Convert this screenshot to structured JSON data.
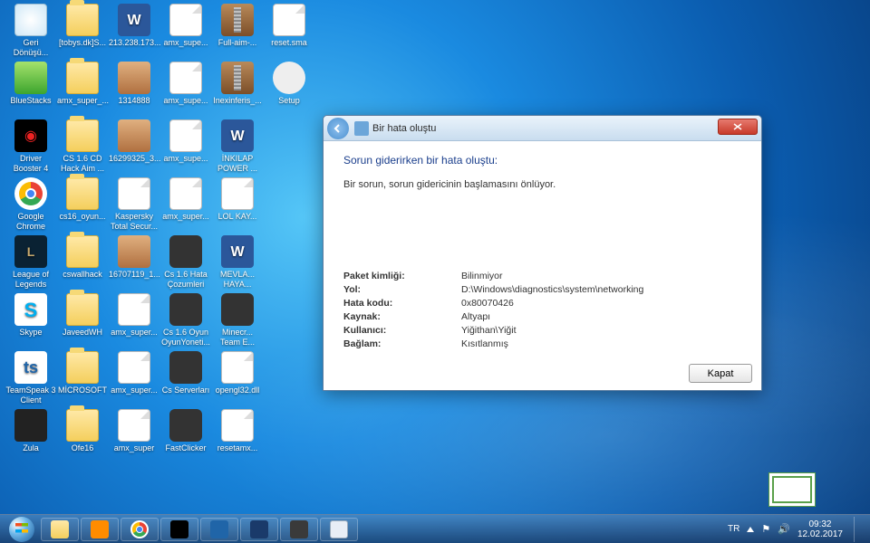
{
  "desktop_icons": [
    {
      "r": 0,
      "c": 0,
      "t": "recycle",
      "label": "Geri Dönüşü..."
    },
    {
      "r": 0,
      "c": 1,
      "t": "folder",
      "label": "[tobys.dk]S..."
    },
    {
      "r": 0,
      "c": 2,
      "t": "word",
      "label": "213.238.173..."
    },
    {
      "r": 0,
      "c": 3,
      "t": "file",
      "label": "amx_supe..."
    },
    {
      "r": 0,
      "c": 4,
      "t": "rar",
      "label": "Full-aim-..."
    },
    {
      "r": 0,
      "c": 5,
      "t": "file",
      "label": "reset.sma"
    },
    {
      "r": 1,
      "c": 0,
      "t": "bluestacks",
      "label": "BlueStacks"
    },
    {
      "r": 1,
      "c": 1,
      "t": "folder",
      "label": "amx_super_..."
    },
    {
      "r": 1,
      "c": 2,
      "t": "pic",
      "label": "1314888"
    },
    {
      "r": 1,
      "c": 3,
      "t": "file",
      "label": "amx_supe..."
    },
    {
      "r": 1,
      "c": 4,
      "t": "rar",
      "label": "Inexinferis_..."
    },
    {
      "r": 1,
      "c": 5,
      "t": "setup",
      "label": "Setup"
    },
    {
      "r": 2,
      "c": 0,
      "t": "driver",
      "label": "Driver Booster 4"
    },
    {
      "r": 2,
      "c": 1,
      "t": "folder",
      "label": "CS 1.6 CD Hack Aim ..."
    },
    {
      "r": 2,
      "c": 2,
      "t": "pic",
      "label": "16299325_3..."
    },
    {
      "r": 2,
      "c": 3,
      "t": "file",
      "label": "amx_supe..."
    },
    {
      "r": 2,
      "c": 4,
      "t": "word",
      "label": "İNKILAP POWER ..."
    },
    {
      "r": 3,
      "c": 0,
      "t": "chrome",
      "label": "Google Chrome"
    },
    {
      "r": 3,
      "c": 1,
      "t": "folder",
      "label": "cs16_oyun..."
    },
    {
      "r": 3,
      "c": 2,
      "t": "file",
      "label": "Kaspersky Total Secur..."
    },
    {
      "r": 3,
      "c": 3,
      "t": "file",
      "label": "amx_super..."
    },
    {
      "r": 3,
      "c": 4,
      "t": "file",
      "label": "LOL KAY..."
    },
    {
      "r": 4,
      "c": 0,
      "t": "lol",
      "label": "League of Legends"
    },
    {
      "r": 4,
      "c": 1,
      "t": "folder",
      "label": "cswallhack"
    },
    {
      "r": 4,
      "c": 2,
      "t": "pic",
      "label": "16707119_1..."
    },
    {
      "r": 4,
      "c": 3,
      "t": "app",
      "label": "Cs 1.6 Hata Çozumleri"
    },
    {
      "r": 4,
      "c": 4,
      "t": "word",
      "label": "MEVLA... HAYA..."
    },
    {
      "r": 5,
      "c": 0,
      "t": "skype",
      "label": "Skype"
    },
    {
      "r": 5,
      "c": 1,
      "t": "folder",
      "label": "JaveedWH"
    },
    {
      "r": 5,
      "c": 2,
      "t": "file",
      "label": "amx_super..."
    },
    {
      "r": 5,
      "c": 3,
      "t": "app",
      "label": "Cs 1.6 Oyun OyunYoneti..."
    },
    {
      "r": 5,
      "c": 4,
      "t": "app",
      "label": "Minecr... Team E..."
    },
    {
      "r": 6,
      "c": 0,
      "t": "ts",
      "label": "TeamSpeak 3 Client"
    },
    {
      "r": 6,
      "c": 1,
      "t": "folder",
      "label": "MİCROSOFT"
    },
    {
      "r": 6,
      "c": 2,
      "t": "file",
      "label": "amx_super..."
    },
    {
      "r": 6,
      "c": 3,
      "t": "app",
      "label": "Cs Serverları"
    },
    {
      "r": 6,
      "c": 4,
      "t": "file",
      "label": "opengl32.dll"
    },
    {
      "r": 7,
      "c": 0,
      "t": "zula",
      "label": "Zula"
    },
    {
      "r": 7,
      "c": 1,
      "t": "folder",
      "label": "Ofe16"
    },
    {
      "r": 7,
      "c": 2,
      "t": "file",
      "label": "amx_super"
    },
    {
      "r": 7,
      "c": 3,
      "t": "app",
      "label": "FastClicker"
    },
    {
      "r": 7,
      "c": 4,
      "t": "file",
      "label": "resetamx..."
    }
  ],
  "dialog": {
    "title": "Bir hata oluştu",
    "heading": "Sorun giderirken bir hata oluştu:",
    "message": "Bir sorun, sorun gidericinin başlamasını önlüyor.",
    "details": [
      {
        "k": "Paket kimliği:",
        "v": "Bilinmiyor"
      },
      {
        "k": "Yol:",
        "v": "D:\\Windows\\diagnostics\\system\\networking"
      },
      {
        "k": "Hata kodu:",
        "v": "0x80070426"
      },
      {
        "k": "Kaynak:",
        "v": "Altyapı"
      },
      {
        "k": "Kullanıcı:",
        "v": "Yiğithan\\Yiğit"
      },
      {
        "k": "Bağlam:",
        "v": "Kısıtlanmış"
      }
    ],
    "close_label": "Kapat"
  },
  "taskbar": {
    "items": [
      "explorer",
      "media",
      "chrome",
      "driver",
      "ts",
      "fast",
      "cs",
      "dlg"
    ],
    "lang": "TR",
    "time": "09:32",
    "date": "12.02.2017"
  }
}
